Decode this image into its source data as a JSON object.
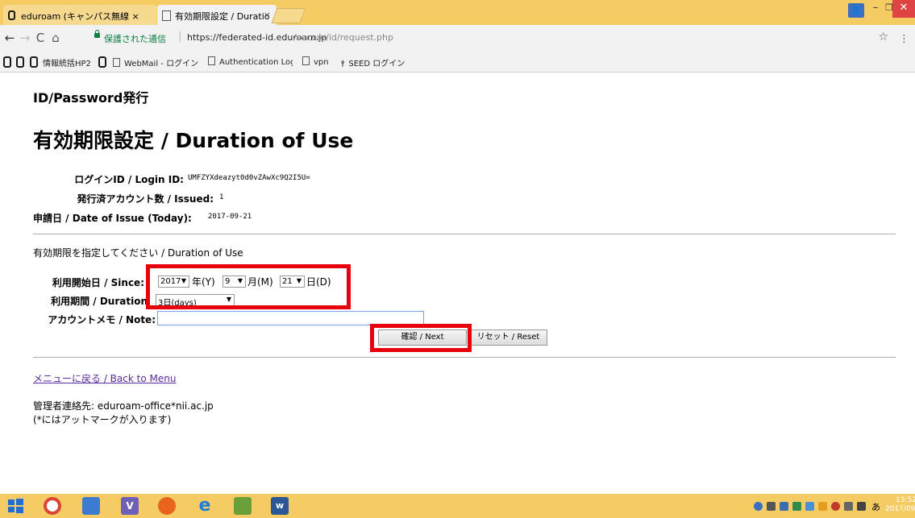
{
  "browser": {
    "tabs": [
      {
        "title": "eduroam (キャンパス無線 ×",
        "active": false
      },
      {
        "title": "有効期限設定 / Duratio",
        "active": true
      }
    ],
    "tab_close": "×",
    "omnibox": {
      "secure_label": "保護された通信",
      "url_host": "https://federated-id.eduroam.jp",
      "url_path": "/secure/id/request.php"
    },
    "bookmarks": [
      "情報統括HP2",
      "WebMail - ログイン",
      "Authentication Log",
      "vpn",
      "SEED ログイン"
    ],
    "colors": {
      "tabstrip": "#f5cc63",
      "toolbar": "#f2f2f2",
      "secure": "#0b8043"
    }
  },
  "page": {
    "heading_small": "ID/Password発行",
    "heading_large": "有効期限設定 / Duration of Use",
    "info": [
      {
        "label": "ログインID / Login ID:",
        "value": "UMFZYXdeazyt0d0vZAwXc9Q2I5U="
      },
      {
        "label": "発行済アカウント数 / Issued:",
        "value": "1"
      },
      {
        "label": "申請日 / Date of Issue (Today):",
        "value": "2017-09-21"
      }
    ],
    "instruction": "有効期限を指定してください / Duration of Use",
    "form": {
      "since_label": "利用開始日 / Since:",
      "year": "2017",
      "year_unit": "年(Y)",
      "month": "9",
      "month_unit": "月(M)",
      "day": "21",
      "day_unit": "日(D)",
      "duration_label": "利用期間 / Duration",
      "duration": "3日(days)",
      "note_label": "アカウントメモ / Note:",
      "note_value": "",
      "next_button": "確認 / Next",
      "reset_button": "リセット / Reset",
      "dropdown_arrow": "▼"
    },
    "back_link": "メニューに戻る / Back to Menu",
    "contact": "管理者連絡先: eduroam-office*nii.ac.jp",
    "contact_note": "(*にはアットマークが入ります)",
    "highlight_color": "#e8000b"
  },
  "taskbar": {
    "clock_time": "13:52",
    "clock_date": "2017/09/21",
    "ime": "あ",
    "apps": [
      "windows-start",
      "chrome",
      "explorer",
      "visio",
      "firefox",
      "internet-explorer",
      "notepad",
      "word"
    ]
  }
}
